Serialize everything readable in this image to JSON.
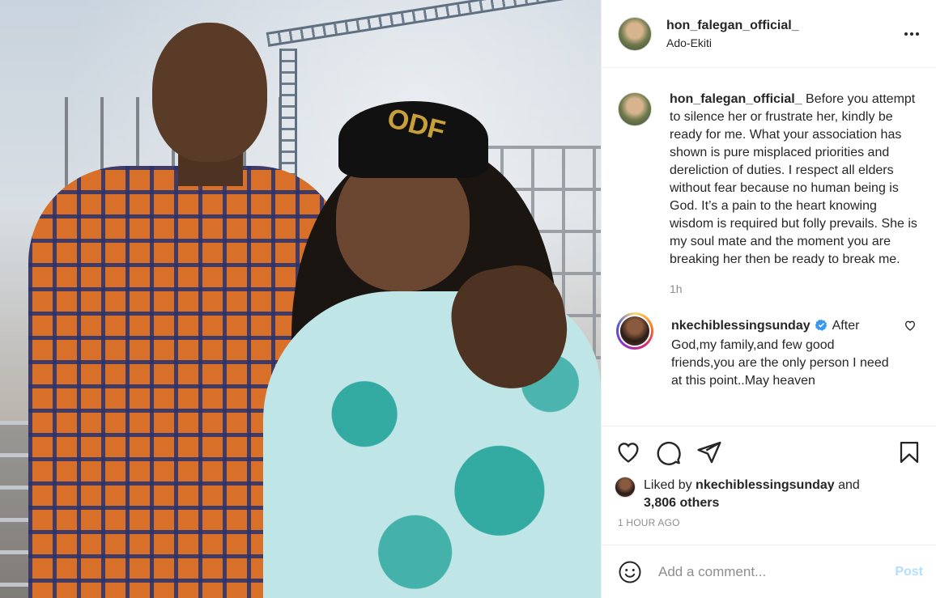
{
  "post": {
    "author": {
      "username": "hon_falegan_official_",
      "location": "Ado-Ekiti"
    },
    "photo": {
      "cap_text": "ODF"
    },
    "caption": {
      "author": "hon_falegan_official_",
      "text": "Before you attempt to silence her or frustrate her, kindly be ready for me. What your association has shown is pure misplaced priorities and dereliction of duties. I respect all elders without fear because no human being is God. It’s a pain to the heart knowing wisdom is required but folly prevails. She is my soul mate and the moment you are breaking her then be ready to break me.",
      "time": "1h"
    },
    "comments": [
      {
        "author": "nkechiblessingsunday",
        "verified": true,
        "text": "After God,my family,and few good friends,you are the only person I need at this point..May heaven"
      }
    ],
    "likes": {
      "prefix": "Liked by",
      "liker": "nkechiblessingsunday",
      "conjunction": "and",
      "others": "3,806 others"
    },
    "age": "1 HOUR AGO",
    "add_comment": {
      "placeholder": "Add a comment...",
      "post_label": "Post"
    },
    "icons": {
      "more": "more-options-icon",
      "like": "heart-icon",
      "comment": "comment-bubble-icon",
      "share": "paper-plane-icon",
      "save": "bookmark-icon",
      "emoji": "emoji-smiley-icon",
      "verified": "verified-badge-icon"
    },
    "colors": {
      "verified": "#3897f0",
      "post_button_disabled": "#b2dffc",
      "muted_text": "#8e8e8e"
    }
  }
}
